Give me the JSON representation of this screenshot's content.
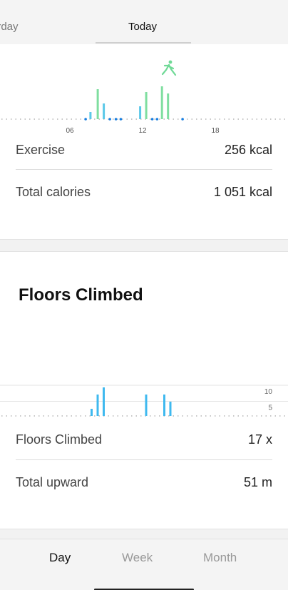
{
  "top_tabs": {
    "prev_label": "erday",
    "today_label": "Today"
  },
  "calories_chart": {
    "type": "bar",
    "x_tick_labels": [
      "06",
      "12",
      "18"
    ],
    "active_icon": "walking-person-icon",
    "bar_color": "#7fdea0",
    "alt_bar_color": "#5bc8e8",
    "dot_color": "#1a7fe0"
  },
  "calories": {
    "exercise_label": "Exercise",
    "exercise_value": "256 kcal",
    "total_label": "Total calories",
    "total_value": "1 051 kcal"
  },
  "floors": {
    "title": "Floors Climbed",
    "climbed_label": "Floors Climbed",
    "climbed_value": "17 x",
    "upward_label": "Total upward",
    "upward_value": "51 m"
  },
  "chart_data": {
    "type": "bar",
    "title": "",
    "y_tick_labels": [
      "10",
      "5"
    ],
    "ylim": [
      0,
      10
    ],
    "values_by_hour": [
      {
        "hour": 7.5,
        "value": 1
      },
      {
        "hour": 8,
        "value": 3
      },
      {
        "hour": 8.5,
        "value": 4
      },
      {
        "hour": 12,
        "value": 3
      },
      {
        "hour": 13.5,
        "value": 3
      },
      {
        "hour": 14,
        "value": 2
      }
    ],
    "bar_color": "#3fb9ef"
  },
  "bottom_tabs": {
    "day": "Day",
    "week": "Week",
    "month": "Month"
  }
}
